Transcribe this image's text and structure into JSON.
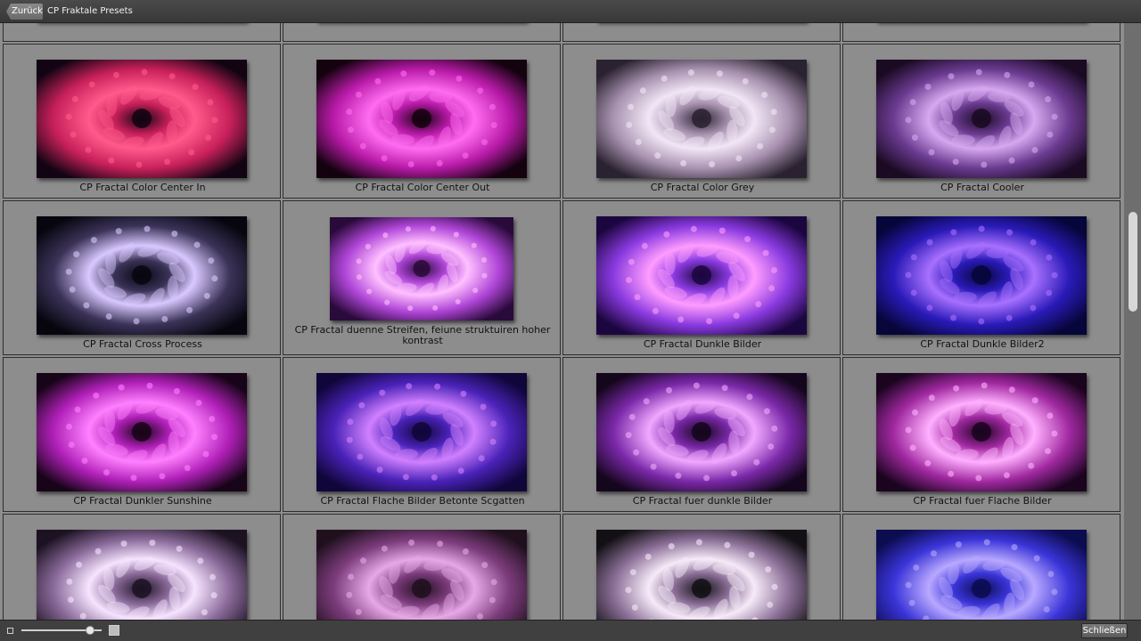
{
  "topbar": {
    "back_label": "Zurück",
    "title": "CP Fraktale Presets"
  },
  "gallery": {
    "rows": [
      [
        "",
        "",
        "",
        ""
      ],
      [
        "CP Fractal Color Center In",
        "CP Fractal Color Center Out",
        "CP Fractal Color Grey",
        "CP Fractal Cooler"
      ],
      [
        "CP Fractal Cross Process",
        "CP Fractal duenne Streifen, feiune struktuiren hoher kontrast",
        "CP Fractal Dunkle Bilder",
        "CP Fractal Dunkle Bilder2"
      ],
      [
        "CP Fractal Dunkler Sunshine",
        "CP Fractal Flache Bilder Betonte Scgatten",
        "CP Fractal fuer dunkle Bilder",
        "CP Fractal fuer Flache Bilder"
      ],
      [
        "",
        "",
        "",
        ""
      ]
    ],
    "thumb_colors": [
      [
        {
          "bg": "#120412",
          "mid": "#c8205a",
          "glow": "#ff5a8c"
        },
        {
          "bg": "#14020e",
          "mid": "#b81aa8",
          "glow": "#ff6cf0"
        },
        {
          "bg": "#2a2230",
          "mid": "#a892b0",
          "glow": "#f2e6f6"
        },
        {
          "bg": "#1a0a22",
          "mid": "#6a3a90",
          "glow": "#d6a8f0"
        }
      ],
      [
        {
          "bg": "#07060f",
          "mid": "#3b3358",
          "glow": "#d8c8ff"
        },
        {
          "bg": "#2a0a3a",
          "mid": "#b046d8",
          "glow": "#ffc0ff"
        },
        {
          "bg": "#1c0640",
          "mid": "#8a3ae0",
          "glow": "#ff9cff"
        },
        {
          "bg": "#06063a",
          "mid": "#2a1ab8",
          "glow": "#a870ff"
        }
      ],
      [
        {
          "bg": "#180418",
          "mid": "#b020b8",
          "glow": "#ff80ff"
        },
        {
          "bg": "#10063a",
          "mid": "#4a22b8",
          "glow": "#d080ff"
        },
        {
          "bg": "#14061c",
          "mid": "#7a28a8",
          "glow": "#f0a8ff"
        },
        {
          "bg": "#1a041e",
          "mid": "#a028a0",
          "glow": "#ffb0ff"
        }
      ],
      [
        {
          "bg": "#1c1222",
          "mid": "#8a6a9a",
          "glow": "#f6e4ff"
        },
        {
          "bg": "#20101e",
          "mid": "#7c3c7c",
          "glow": "#e6a8e6"
        },
        {
          "bg": "#121014",
          "mid": "#8a6e96",
          "glow": "#f6eaf8"
        },
        {
          "bg": "#0c0c50",
          "mid": "#3a34d8",
          "glow": "#b8a8ff"
        }
      ]
    ]
  },
  "scrollbar": {
    "position_fraction": 0.34
  },
  "bottombar": {
    "zoom_level": 0.85,
    "close_label": "Schließen"
  }
}
